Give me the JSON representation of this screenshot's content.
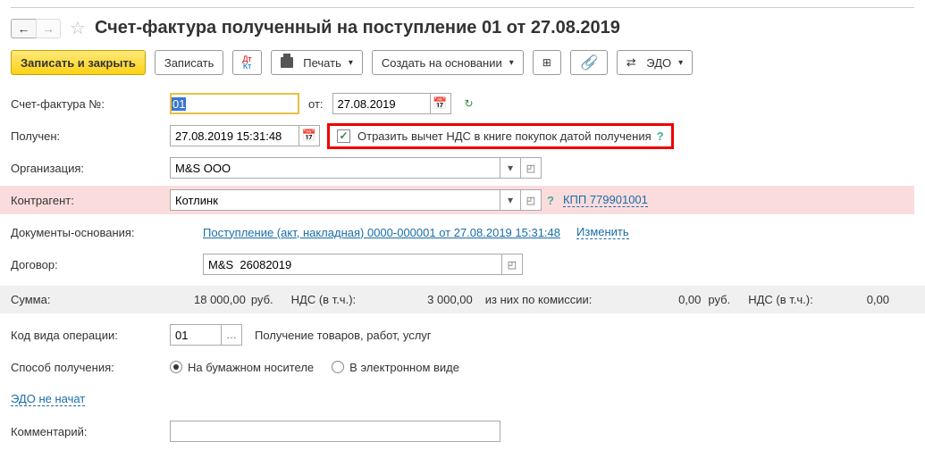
{
  "header": {
    "title": "Счет-фактура полученный на поступление 01 от 27.08.2019"
  },
  "toolbar": {
    "save_close": "Записать и закрыть",
    "save": "Записать",
    "print": "Печать",
    "create_based": "Создать на основании",
    "edo": "ЭДО"
  },
  "fields": {
    "invoice_num_label": "Счет-фактура №:",
    "invoice_num_value": "01",
    "from_label": "от:",
    "from_date": "27.08.2019",
    "received_label": "Получен:",
    "received_dt": "27.08.2019 15:31:48",
    "vat_checkbox_label": "Отразить вычет НДС в книге покупок датой получения",
    "org_label": "Организация:",
    "org_value": "M&S ООО",
    "contractor_label": "Контрагент:",
    "contractor_value": "Котлинк",
    "kpp_label": "КПП 779901001",
    "docs_label": "Документы-основания:",
    "docs_link": "Поступление (акт, накладная) 0000-000001 от 27.08.2019 15:31:48",
    "docs_change": "Изменить",
    "contract_label": "Договор:",
    "contract_value": "M&S  26082019",
    "opcode_label": "Код вида операции:",
    "opcode_value": "01",
    "opcode_desc": "Получение товаров, работ, услуг",
    "recv_mode_label": "Способ получения:",
    "recv_mode_paper": "На бумажном носителе",
    "recv_mode_elec": "В электронном виде",
    "edo_status": "ЭДО не начат",
    "comment_label": "Комментарий:",
    "comment_value": ""
  },
  "sums": {
    "sum_label": "Сумма:",
    "sum_value": "18 000,00",
    "rub": "руб.",
    "vat_label": "НДС (в т.ч.):",
    "vat_value": "3 000,00",
    "commission_label": "из них по комиссии:",
    "commission_value": "0,00",
    "vat2_label": "НДС (в т.ч.):",
    "vat2_value": "0,00"
  }
}
